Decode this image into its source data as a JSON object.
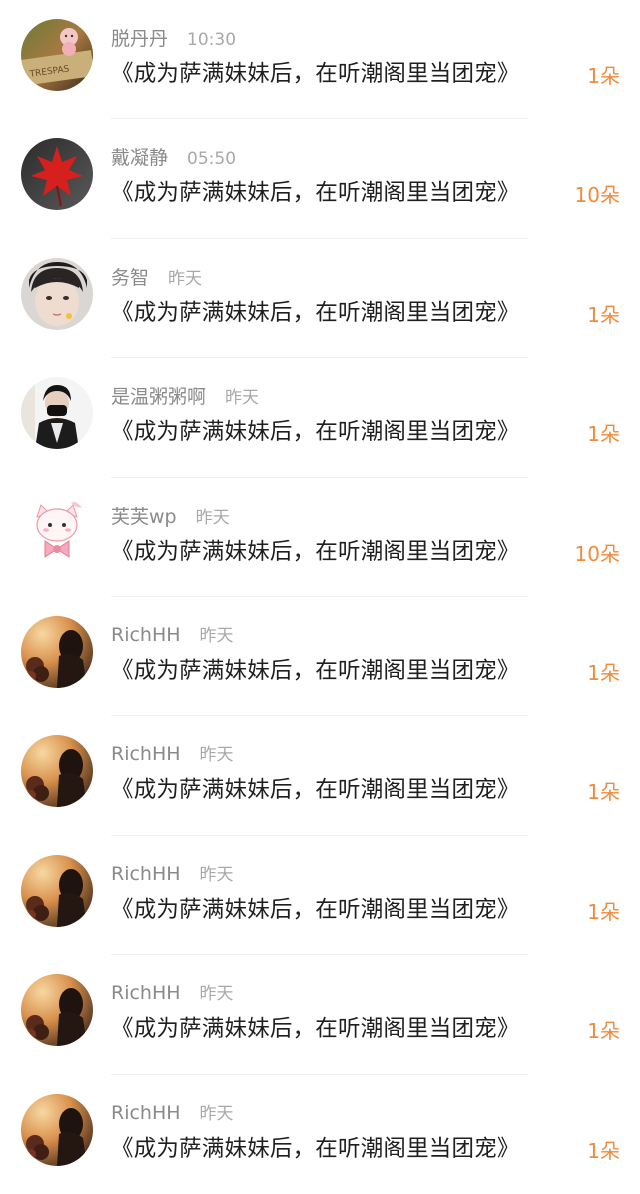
{
  "entries": [
    {
      "name": "脱丹丹",
      "time": "10:30",
      "title": "《成为萨满妹妹后，在听潮阁里当团宠》",
      "gift": "1朵",
      "avatar": "avatar-pig-sign"
    },
    {
      "name": "戴凝静",
      "time": "05:50",
      "title": "《成为萨满妹妹后，在听潮阁里当团宠》",
      "gift": "10朵",
      "avatar": "avatar-maple-leaf"
    },
    {
      "name": "务智",
      "time": "昨天",
      "title": "《成为萨满妹妹后，在听潮阁里当团宠》",
      "gift": "1朵",
      "avatar": "avatar-boy-face"
    },
    {
      "name": "是温粥粥啊",
      "time": "昨天",
      "title": "《成为萨满妹妹后，在听潮阁里当团宠》",
      "gift": "1朵",
      "avatar": "avatar-masked-person"
    },
    {
      "name": "芙芙wp",
      "time": "昨天",
      "title": "《成为萨满妹妹后，在听潮阁里当团宠》",
      "gift": "10朵",
      "avatar": "avatar-pink-cat"
    },
    {
      "name": "RichHH",
      "time": "昨天",
      "title": "《成为萨满妹妹后，在听潮阁里当团宠》",
      "gift": "1朵",
      "avatar": "avatar-sunset-girl"
    },
    {
      "name": "RichHH",
      "time": "昨天",
      "title": "《成为萨满妹妹后，在听潮阁里当团宠》",
      "gift": "1朵",
      "avatar": "avatar-sunset-girl"
    },
    {
      "name": "RichHH",
      "time": "昨天",
      "title": "《成为萨满妹妹后，在听潮阁里当团宠》",
      "gift": "1朵",
      "avatar": "avatar-sunset-girl"
    },
    {
      "name": "RichHH",
      "time": "昨天",
      "title": "《成为萨满妹妹后，在听潮阁里当团宠》",
      "gift": "1朵",
      "avatar": "avatar-sunset-girl"
    },
    {
      "name": "RichHH",
      "time": "昨天",
      "title": "《成为萨满妹妹后，在听潮阁里当团宠》",
      "gift": "1朵",
      "avatar": "avatar-sunset-girl"
    }
  ],
  "colors": {
    "gift": "#f08a3c",
    "name": "#8a8a8a",
    "time": "#a8a8a8",
    "title": "#1f1f1f",
    "divider": "#efefef"
  }
}
